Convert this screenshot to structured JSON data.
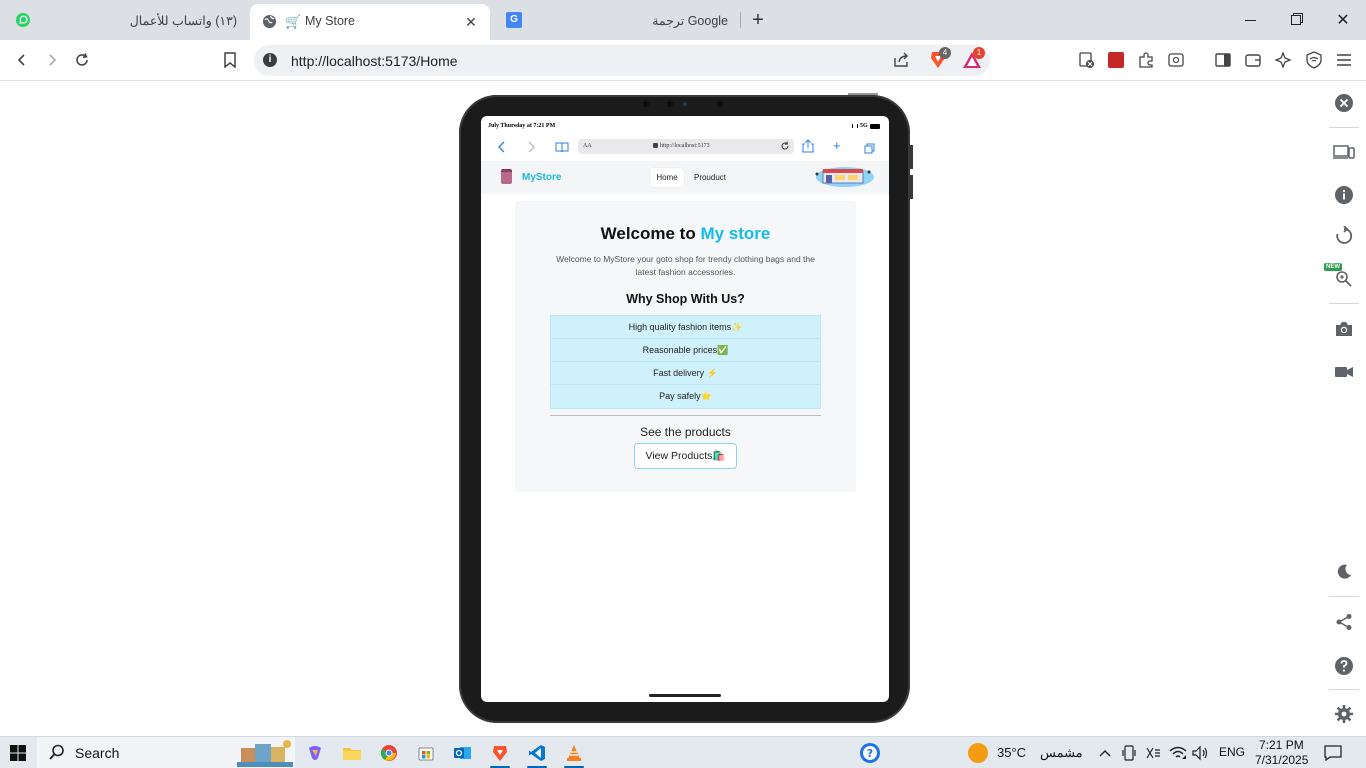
{
  "browser": {
    "tabs": [
      {
        "title": "(١٣) واتساب للأعمال"
      },
      {
        "title": "My Store"
      },
      {
        "title": "ترجمة Google"
      }
    ],
    "address_url": "http://localhost:5173/Home",
    "badges": {
      "brave_shields": "4",
      "rewards": "1"
    }
  },
  "ios": {
    "status_left": "July Thursday at 7:21 PM",
    "status_right": "5G",
    "safari_aa": "AA",
    "safari_url": "http://localhost:5173"
  },
  "site": {
    "brand": "MyStore",
    "nav": [
      "Home",
      "Prouduct"
    ],
    "welcome_prefix": "Welcome to ",
    "welcome_accent": "My store",
    "intro": "Welcome to MyStore your goto shop for trendy clothing bags and the latest fashion accessories.",
    "why_title": "Why Shop With Us?",
    "features": [
      "High quality fashion items✨",
      "Reasonable prices✅",
      "Fast delivery ⚡",
      "Pay safely⭐"
    ],
    "see_products": "See the products",
    "view_button": "View Products🛍️"
  },
  "sidepanel": {
    "new_badge": "NEW"
  },
  "taskbar": {
    "search": "Search",
    "weather_temp": "35°C",
    "weather_text": "مشمس",
    "lang": "ENG",
    "time": "7:21 PM",
    "date": "7/31/2025"
  },
  "colors": {
    "accent": "#14bde8",
    "feature_bg": "#cff1fb",
    "tab_strip": "#dcdfe4"
  }
}
